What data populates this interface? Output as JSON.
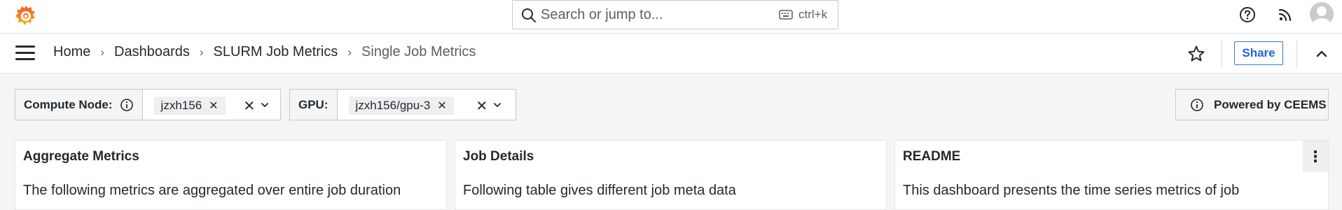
{
  "topbar": {
    "logo_icon": "grafana-logo",
    "search": {
      "placeholder": "Search or jump to...",
      "shortcut": "ctrl+k"
    },
    "icons": [
      "help-icon",
      "news-rss-icon",
      "user-avatar"
    ]
  },
  "navbar": {
    "breadcrumbs": [
      "Home",
      "Dashboards",
      "SLURM Job Metrics",
      "Single Job Metrics"
    ],
    "separator": "›",
    "share_label": "Share"
  },
  "variables": [
    {
      "label": "Compute Node:",
      "has_info": true,
      "value": "jzxh156"
    },
    {
      "label": "GPU:",
      "has_info": false,
      "value": "jzxh156/gpu-3"
    }
  ],
  "powered_by": "Powered by CEEMS",
  "panels": [
    {
      "title": "Aggregate Metrics",
      "body": "The following metrics are aggregated over entire job duration"
    },
    {
      "title": "Job Details",
      "body": "Following table gives different job meta data"
    },
    {
      "title": "README",
      "body": "This dashboard presents the time series metrics of job"
    }
  ],
  "colors": {
    "accent": "#1f62e0",
    "logo_orange": "#f05a28",
    "background": "#f4f5f5"
  }
}
